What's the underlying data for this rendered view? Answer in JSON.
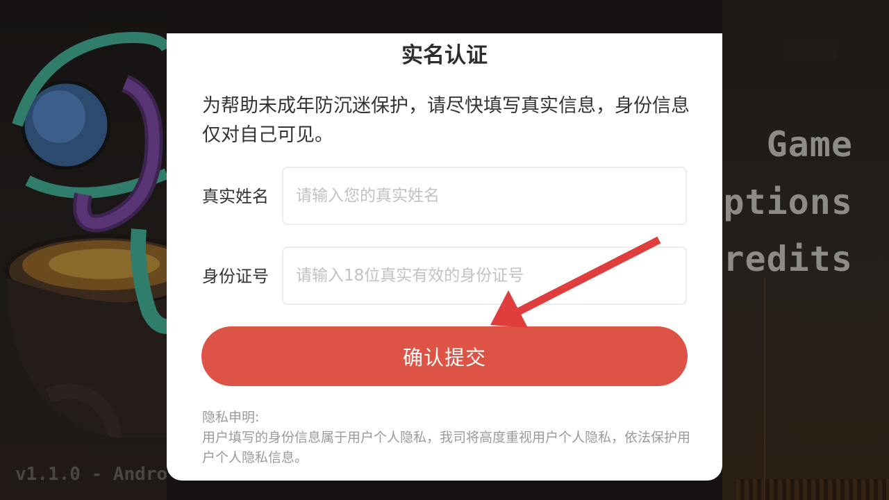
{
  "background": {
    "menu_items": [
      "Game",
      "ptions",
      "redits"
    ],
    "version": "v1.1.0 - Andro"
  },
  "dialog": {
    "title": "实名认证",
    "intro": "为帮助未成年防沉迷保护，请尽快填写真实信息，身份信息仅对自己可见。",
    "name_field": {
      "label": "真实姓名",
      "value": "",
      "placeholder": "请输入您的真实姓名"
    },
    "id_field": {
      "label": "身份证号",
      "value": "",
      "placeholder": "请输入18位真实有效的身份证号"
    },
    "submit_label": "确认提交",
    "privacy_title": "隐私申明:",
    "privacy_body": "用户填写的身份信息属于用户个人隐私，我司将高度重视用户个人隐私，依法保护用户个人隐私信息。"
  },
  "colors": {
    "accent": "#dd5345",
    "arrow": "#e03d3d",
    "backdrop": "#141110"
  },
  "icons": [
    "arrow-annotation-icon"
  ]
}
